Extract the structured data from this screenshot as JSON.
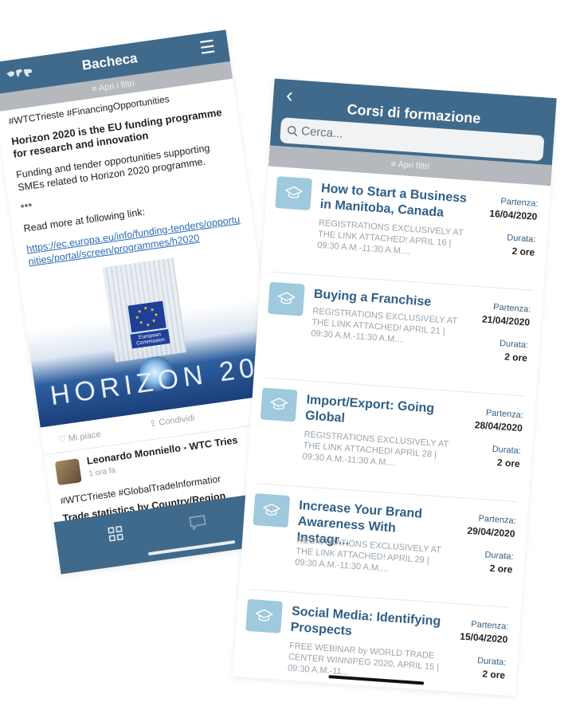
{
  "left_app": {
    "header": {
      "title": "Bacheca",
      "map_icon": "world-map-icon",
      "menu_icon": "hamburger-menu-icon"
    },
    "filter_label": "Apri i filtri",
    "post": {
      "hashtags": "#WTCTrieste #FinancingOpportunities",
      "headline": "Horizon 2020 is the EU funding programme for research and innovation",
      "body": "Funding and tender opportunities supporting SMEs related to Horizon 2020 programme.",
      "separator": "***",
      "read_more": "Read more at following link:",
      "link": "https://ec.europa.eu/info/funding-tenders/opportunities/portal/screen/programmes/h2020",
      "image": {
        "commission_label": "European Commission",
        "horizon_text": "HORIZON 20"
      }
    },
    "actions": {
      "like": "Mi piace",
      "share": "Condividi"
    },
    "post2": {
      "author": "Leonardo Monniello - WTC Tries",
      "time": "1 ora fa",
      "hashtags": "#WTCTrieste #GlobalTradeInformatior",
      "title": "Trade statistics by Country/Region"
    },
    "colors": {
      "primary": "#3f6a8c",
      "filter_bar": "#b5b9be",
      "link": "#2a6db5"
    }
  },
  "right_app": {
    "header": {
      "title": "Corsi di formazione",
      "back_icon": "chevron-left-icon"
    },
    "search": {
      "placeholder": "Cerca..."
    },
    "filter_label": "Apri filtri",
    "labels": {
      "start": "Partenza:",
      "duration": "Durata:"
    },
    "courses": [
      {
        "title": "How to Start a Business in Manitoba, Canada",
        "description": "REGISTRATIONS EXCLUSIVELY AT THE LINK ATTACHED! APRIL 16 | 09:30 A.M.-11:30 A.M....",
        "start": "16/04/2020",
        "duration": "2 ore"
      },
      {
        "title": "Buying a Franchise",
        "description": "REGISTRATIONS EXCLUSIVELY AT THE LINK ATTACHED! APRIL 21 | 09:30 A.M.-11:30 A.M....",
        "start": "21/04/2020",
        "duration": "2 ore"
      },
      {
        "title": "Import/Export: Going Global",
        "description": "REGISTRATIONS EXCLUSIVELY AT THE LINK ATTACHED! APRIL 28 | 09:30 A.M.-11:30 A.M....",
        "start": "28/04/2020",
        "duration": "2 ore"
      },
      {
        "title": "Increase Your Brand Awareness With Instagr...",
        "description": "REGISTRATIONS EXCLUSIVELY AT THE LINK ATTACHED! APRIL 29 | 09:30 A.M.-11:30 A.M....",
        "start": "29/04/2020",
        "duration": "2 ore"
      },
      {
        "title": "Social Media: Identifying Prospects",
        "description": "FREE WEBINAR by WORLD TRADE CENTER WINNIPEG 2020, APRIL 15 | 09:30 A.M.-11...",
        "start": "15/04/2020",
        "duration": "2 ore"
      }
    ],
    "colors": {
      "primary": "#3f6a8c",
      "course_title": "#2f5e86",
      "icon_bg": "#9fc9dc"
    }
  }
}
